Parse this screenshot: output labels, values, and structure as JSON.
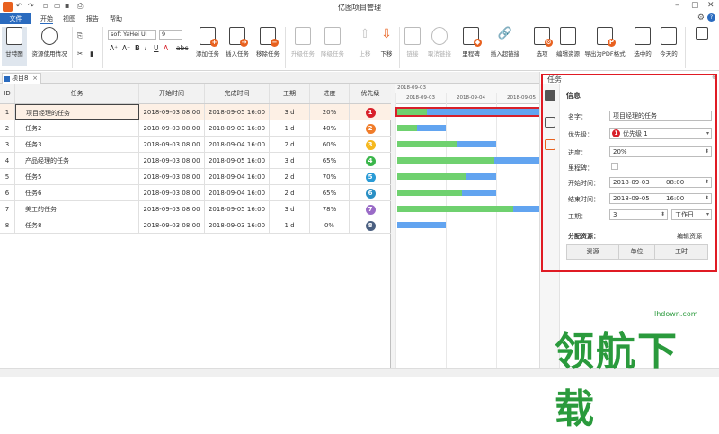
{
  "app": {
    "title": "亿图项目管理",
    "menus": [
      "文件",
      "开始",
      "视图",
      "报告",
      "帮助"
    ]
  },
  "ribbon": {
    "gantt": "甘特图",
    "resource_usage": "资源使用情况",
    "font_name": "soft YaHei UI",
    "font_size": "9",
    "add_task": "添加任务",
    "insert_task": "插入任务",
    "remove_task": "移除任务",
    "upgrade_task": "升级任务",
    "downgrade_task": "降级任务",
    "move_up": "上移",
    "move_down": "下移",
    "link": "链接",
    "unlink": "取消链接",
    "milestone": "里程碑",
    "insert_hyperlink": "插入超链接",
    "options": "选项",
    "edit_resource": "编辑资源",
    "export_pdf": "导出为PDF格式",
    "selected": "选中的",
    "today": "今天的"
  },
  "tabs": {
    "project": "项目8"
  },
  "table": {
    "headers": [
      "ID",
      "任务",
      "开始时间",
      "完成时间",
      "工期",
      "进度",
      "优先级"
    ],
    "rows": [
      {
        "id": "1",
        "task": "项目经理的任务",
        "start": "2018-09-03 08:00",
        "end": "2018-09-05 16:00",
        "dur": "3 d",
        "prog": "20%",
        "pri": "1",
        "color": "#d8202a"
      },
      {
        "id": "2",
        "task": "任务2",
        "start": "2018-09-03 08:00",
        "end": "2018-09-03 16:00",
        "dur": "1 d",
        "prog": "40%",
        "pri": "2",
        "color": "#f07c2a"
      },
      {
        "id": "3",
        "task": "任务3",
        "start": "2018-09-03 08:00",
        "end": "2018-09-04 16:00",
        "dur": "2 d",
        "prog": "60%",
        "pri": "3",
        "color": "#f5b81e"
      },
      {
        "id": "4",
        "task": "产品经理的任务",
        "start": "2018-09-03 08:00",
        "end": "2018-09-05 16:00",
        "dur": "3 d",
        "prog": "65%",
        "pri": "4",
        "color": "#3ab64a"
      },
      {
        "id": "5",
        "task": "任务5",
        "start": "2018-09-03 08:00",
        "end": "2018-09-04 16:00",
        "dur": "2 d",
        "prog": "70%",
        "pri": "5",
        "color": "#2a9bd6"
      },
      {
        "id": "6",
        "task": "任务6",
        "start": "2018-09-03 08:00",
        "end": "2018-09-04 16:00",
        "dur": "2 d",
        "prog": "65%",
        "pri": "6",
        "color": "#2a8fc4"
      },
      {
        "id": "7",
        "task": "美工的任务",
        "start": "2018-09-03 08:00",
        "end": "2018-09-05 16:00",
        "dur": "3 d",
        "prog": "78%",
        "pri": "7",
        "color": "#9a6bc7"
      },
      {
        "id": "8",
        "task": "任务8",
        "start": "2018-09-03 08:00",
        "end": "2018-09-03 16:00",
        "dur": "1 d",
        "prog": "0%",
        "pri": "8",
        "color": "#4a5f80"
      }
    ]
  },
  "gantt": {
    "top_date": "2018-09-03",
    "dates": [
      "2018-09-03",
      "2018-09-04",
      "2018-09-05"
    ],
    "bars": [
      {
        "start_day": 0,
        "days": 3,
        "progress": 0.2
      },
      {
        "start_day": 0,
        "days": 1,
        "progress": 0.4
      },
      {
        "start_day": 0,
        "days": 2,
        "progress": 0.6
      },
      {
        "start_day": 0,
        "days": 3,
        "progress": 0.65
      },
      {
        "start_day": 0,
        "days": 2,
        "progress": 0.7
      },
      {
        "start_day": 0,
        "days": 2,
        "progress": 0.65
      },
      {
        "start_day": 0,
        "days": 3,
        "progress": 0.78
      },
      {
        "start_day": 0,
        "days": 1,
        "progress": 0.0
      }
    ]
  },
  "panel": {
    "title": "任务",
    "section": "信息",
    "name_label": "名字：",
    "name_value": "项目经理的任务",
    "priority_label": "优先级：",
    "priority_value": "优先级 1",
    "progress_label": "进度：",
    "progress_value": "20%",
    "milestone_label": "里程碑：",
    "start_label": "开始时间：",
    "start_date": "2018-09-03",
    "start_time": "08:00",
    "end_label": "结束时间：",
    "end_date": "2018-09-05",
    "end_time": "16:00",
    "duration_label": "工期：",
    "duration_value": "3",
    "duration_unit": "工作日",
    "assign_label": "分配资源：",
    "edit_resource": "编辑资源",
    "res_headers": [
      "资源",
      "单位",
      "工时"
    ]
  },
  "watermark": {
    "text": "领航下载",
    "url": "lhdown.com"
  }
}
